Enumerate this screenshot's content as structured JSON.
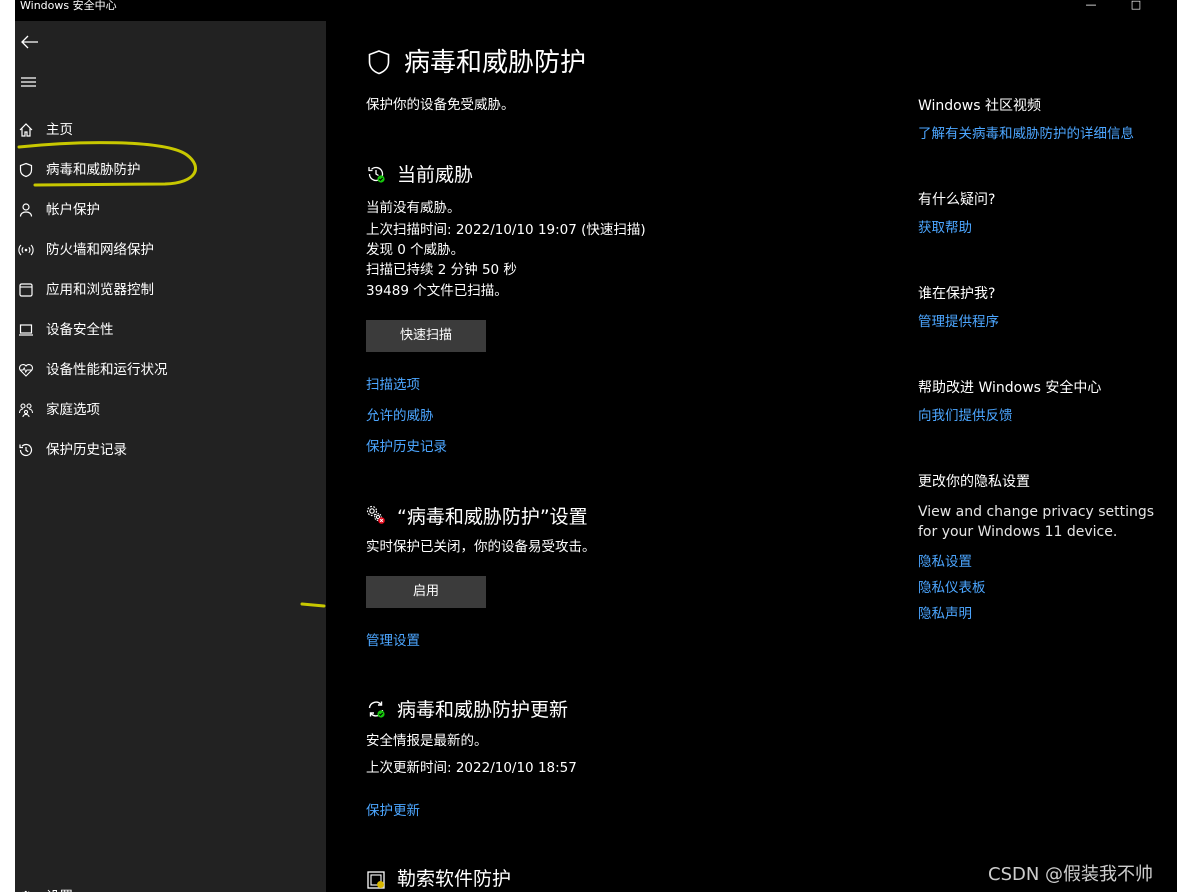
{
  "window": {
    "title": "Windows 安全中心",
    "minimize_glyph": "—",
    "maximize_glyph": "□"
  },
  "sidebar": {
    "items": [
      {
        "label": "主页",
        "icon": "home-icon"
      },
      {
        "label": "病毒和威胁防护",
        "icon": "shield-icon"
      },
      {
        "label": "帐户保护",
        "icon": "person-icon"
      },
      {
        "label": "防火墙和网络保护",
        "icon": "wifi-antenna-icon"
      },
      {
        "label": "应用和浏览器控制",
        "icon": "app-window-icon"
      },
      {
        "label": "设备安全性",
        "icon": "laptop-icon"
      },
      {
        "label": "设备性能和运行状况",
        "icon": "heart-pulse-icon"
      },
      {
        "label": "家庭选项",
        "icon": "family-icon"
      },
      {
        "label": "保护历史记录",
        "icon": "history-icon"
      }
    ],
    "settings_label": "设置"
  },
  "page": {
    "title": "病毒和威胁防护",
    "subtitle": "保护你的设备免受威胁。"
  },
  "current_threats": {
    "title": "当前威胁",
    "lines": [
      "当前没有威胁。",
      "上次扫描时间: 2022/10/10 19:07 (快速扫描)",
      "发现 0 个威胁。",
      "扫描已持续 2 分钟 50 秒",
      "39489 个文件已扫描。"
    ],
    "quick_scan_label": "快速扫描",
    "links": [
      "扫描选项",
      "允许的威胁",
      "保护历史记录"
    ]
  },
  "protection_settings": {
    "title": "“病毒和威胁防护”设置",
    "status": "实时保护已关闭，你的设备易受攻击。",
    "enable_label": "启用",
    "manage_link": "管理设置"
  },
  "updates": {
    "title": "病毒和威胁防护更新",
    "status": "安全情报是最新的。",
    "last_update": "上次更新时间: 2022/10/10 18:57",
    "link": "保护更新"
  },
  "ransomware": {
    "title": "勒索软件防护"
  },
  "right": {
    "community_title": "Windows 社区视频",
    "community_link": "了解有关病毒和威胁防护的详细信息",
    "questions_title": "有什么疑问?",
    "questions_link": "获取帮助",
    "who_title": "谁在保护我?",
    "who_link": "管理提供程序",
    "improve_title": "帮助改进 Windows 安全中心",
    "improve_link": "向我们提供反馈",
    "privacy_title": "更改你的隐私设置",
    "privacy_text": "View and change privacy settings for your Windows 11 device.",
    "privacy_links": [
      "隐私设置",
      "隐私仪表板",
      "隐私声明"
    ]
  },
  "watermark": "CSDN @假装我不帅",
  "colors": {
    "link": "#4ca6ff",
    "sidebar_bg": "#222222",
    "main_bg": "#000000",
    "button_bg": "#3b3b3b",
    "ok_green": "#16c60c",
    "warn_red": "#e81123",
    "scribble_yellow": "#c8c800"
  }
}
